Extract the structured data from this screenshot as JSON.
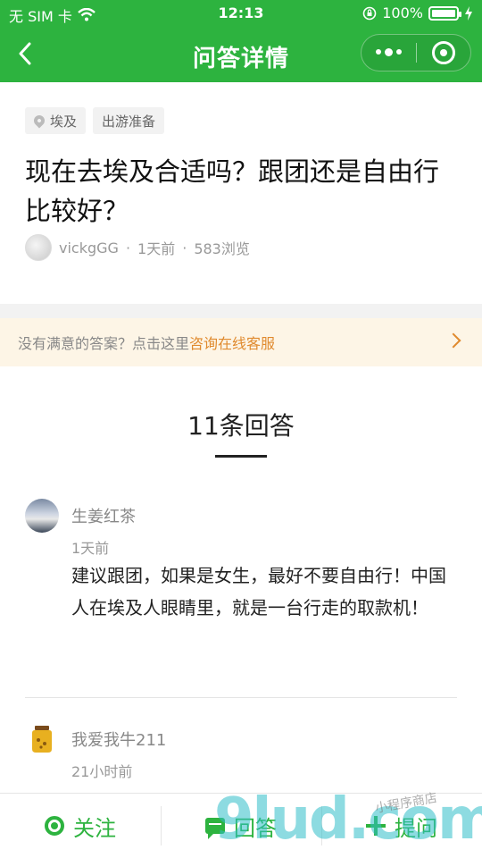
{
  "status_bar": {
    "carrier": "无 SIM 卡",
    "time": "12:13",
    "battery": "100%"
  },
  "nav": {
    "title": "问答详情"
  },
  "question": {
    "tags": [
      "埃及",
      "出游准备"
    ],
    "title": "现在去埃及合适吗？跟团还是自由行比较好？",
    "author": "vickgGG",
    "time_ago": "1天前",
    "views": "583浏览",
    "dot_sep": "·"
  },
  "notice": {
    "text": "没有满意的答案？点击这里",
    "link": "咨询在线客服"
  },
  "answers_header": {
    "count": "11条回答"
  },
  "answers": [
    {
      "name": "生姜红茶",
      "time": "1天前",
      "body": "建议跟团，如果是女生，最好不要自由行！中国人在埃及人眼睛里，就是一台行走的取款机！"
    },
    {
      "name": "我爱我牛211",
      "time": "21小时前",
      "body": ""
    }
  ],
  "bottom_bar": {
    "follow": "关注",
    "reply": "回答",
    "ask": "提问"
  },
  "watermark": {
    "main": "9lud.com",
    "sub": "小程序商店"
  },
  "colors": {
    "brand_green": "#2db33f",
    "notice_link": "#e08a2e",
    "notice_bg": "#fdf5e6"
  },
  "icons": {
    "back": "chevron-left-icon",
    "more": "more-dots-icon",
    "close": "target-circle-icon",
    "location": "location-pin-icon",
    "follow": "follow-circle-icon",
    "reply": "chat-bubble-icon",
    "ask": "plus-icon",
    "notice_arrow": "chevron-right-icon"
  }
}
